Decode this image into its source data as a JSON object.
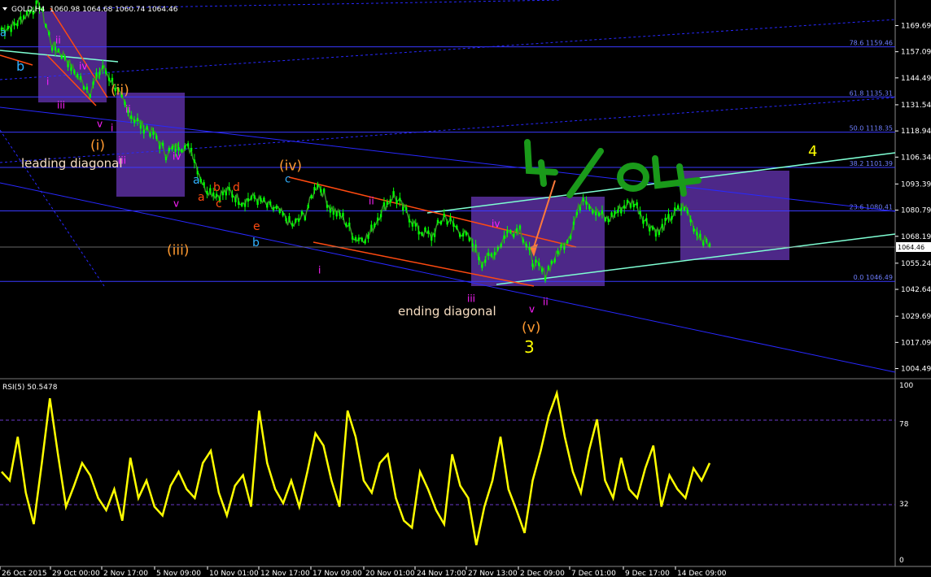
{
  "header": {
    "symbol": "GOLD,H4",
    "ohlc": "1060.98 1064.68 1060.74 1064.46"
  },
  "rsi_header": "RSI(5) 50.5478",
  "colors": {
    "background": "#000000",
    "bull_candle": "#00ff00",
    "price_line": "#3a8f2a",
    "channel_blue": "#2828ff",
    "fib_line": "#3a3aff",
    "orange_line": "#ff4a10",
    "cyan_line": "#7fffd4",
    "box_purple": "#5b2fa0",
    "rsi_line": "#ffff00",
    "yellow": "#ffff00",
    "magenta": "#ff20ff",
    "orange_text": "#ff9a30",
    "cyan_text": "#30b0ff",
    "red_text": "#ff4a10",
    "green_scribble": "#1a9a1a"
  },
  "annotations": {
    "leading_diagonal": "leading diagonal",
    "ending_diagonal": "ending diagonal",
    "wave_3": "3",
    "wave_4": "4"
  },
  "wave_labels": [
    {
      "t": "a",
      "c": "cyan_text"
    },
    {
      "t": "b",
      "c": "cyan_text"
    },
    {
      "t": "ii",
      "c": "magenta"
    },
    {
      "t": "i",
      "c": "magenta"
    },
    {
      "t": "iii",
      "c": "magenta"
    },
    {
      "t": "iv",
      "c": "magenta"
    },
    {
      "t": "v",
      "c": "magenta"
    },
    {
      "t": "(ii)",
      "c": "orange_text"
    },
    {
      "t": "ii",
      "c": "magenta"
    },
    {
      "t": "i",
      "c": "magenta"
    },
    {
      "t": "(i)",
      "c": "orange_text"
    },
    {
      "t": "iii",
      "c": "magenta"
    },
    {
      "t": "iv",
      "c": "magenta"
    },
    {
      "t": "v",
      "c": "magenta"
    },
    {
      "t": "(iii)",
      "c": "orange_text"
    },
    {
      "t": "a",
      "c": "cyan_text"
    },
    {
      "t": "a",
      "c": "red_text"
    },
    {
      "t": "b",
      "c": "red_text"
    },
    {
      "t": "c",
      "c": "red_text"
    },
    {
      "t": "d",
      "c": "red_text"
    },
    {
      "t": "e",
      "c": "red_text"
    },
    {
      "t": "b",
      "c": "cyan_text"
    },
    {
      "t": "(iv)",
      "c": "orange_text"
    },
    {
      "t": "c",
      "c": "cyan_text"
    },
    {
      "t": "ii",
      "c": "magenta"
    },
    {
      "t": "i",
      "c": "magenta"
    },
    {
      "t": "iii",
      "c": "magenta"
    },
    {
      "t": "iv",
      "c": "magenta"
    },
    {
      "t": "v",
      "c": "magenta"
    },
    {
      "t": "ii",
      "c": "magenta"
    },
    {
      "t": "(v)",
      "c": "orange_text"
    }
  ],
  "scribble_text": "4/04",
  "chart_data": [
    {
      "type": "candlestick",
      "title": "",
      "ylim": [
        1000,
        1182
      ],
      "price_ticks": [
        1169.69,
        1157.09,
        1144.49,
        1131.54,
        1118.94,
        1106.34,
        1093.39,
        1080.79,
        1068.19,
        1055.24,
        1042.64,
        1029.69,
        1017.09,
        1004.49
      ],
      "current_price": 1064.46,
      "x_ticks": [
        "26 Oct 2015",
        "29 Oct 00:00",
        "2 Nov 17:00",
        "5 Nov 09:00",
        "10 Nov 01:00",
        "12 Nov 17:00",
        "17 Nov 09:00",
        "20 Nov 01:00",
        "24 Nov 17:00",
        "27 Nov 13:00",
        "2 Dec 09:00",
        "7 Dec 01:00",
        "9 Dec 17:00",
        "14 Dec 09:00"
      ],
      "fib_levels": [
        {
          "label": "78.6 1159.46",
          "value": 1159.46
        },
        {
          "label": "61.8 1135.31",
          "value": 1135.31
        },
        {
          "label": "50.0 1118.35",
          "value": 1118.35
        },
        {
          "label": "38.2 1101.39",
          "value": 1101.39
        },
        {
          "label": "23.6 1080.41",
          "value": 1080.41
        },
        {
          "label": "0.0 1046.49",
          "value": 1046.49
        }
      ],
      "close_path": [
        [
          0,
          1168
        ],
        [
          1,
          1170
        ],
        [
          2,
          1175
        ],
        [
          3,
          1180
        ],
        [
          4,
          1160
        ],
        [
          5,
          1155
        ],
        [
          6,
          1145
        ],
        [
          7,
          1138
        ],
        [
          8,
          1150
        ],
        [
          9,
          1140
        ],
        [
          10,
          1128
        ],
        [
          11,
          1122
        ],
        [
          12,
          1118
        ],
        [
          13,
          1108
        ],
        [
          14,
          1112
        ],
        [
          15,
          1110
        ],
        [
          16,
          1092
        ],
        [
          17,
          1088
        ],
        [
          18,
          1090
        ],
        [
          19,
          1085
        ],
        [
          20,
          1087
        ],
        [
          21,
          1083
        ],
        [
          22,
          1080
        ],
        [
          23,
          1073
        ],
        [
          24,
          1079
        ],
        [
          25,
          1094
        ],
        [
          26,
          1082
        ],
        [
          27,
          1077
        ],
        [
          28,
          1067
        ],
        [
          29,
          1068
        ],
        [
          30,
          1080
        ],
        [
          31,
          1088
        ],
        [
          32,
          1080
        ],
        [
          33,
          1071
        ],
        [
          34,
          1068
        ],
        [
          35,
          1078
        ],
        [
          36,
          1072
        ],
        [
          37,
          1067
        ],
        [
          38,
          1056
        ],
        [
          39,
          1060
        ],
        [
          40,
          1070
        ],
        [
          41,
          1072
        ],
        [
          42,
          1056
        ],
        [
          43,
          1050
        ],
        [
          44,
          1060
        ],
        [
          45,
          1070
        ],
        [
          46,
          1088
        ],
        [
          47,
          1080
        ],
        [
          48,
          1076
        ],
        [
          49,
          1082
        ],
        [
          50,
          1085
        ],
        [
          51,
          1075
        ],
        [
          52,
          1070
        ],
        [
          53,
          1078
        ],
        [
          54,
          1083
        ],
        [
          55,
          1070
        ],
        [
          56,
          1064
        ]
      ]
    },
    {
      "type": "line",
      "title": "RSI(5) 50.5478",
      "ylim": [
        0,
        100
      ],
      "y_ticks": [
        100,
        78,
        32,
        0
      ],
      "values": [
        50,
        45,
        70,
        38,
        20,
        55,
        92,
        60,
        30,
        42,
        55,
        48,
        35,
        28,
        40,
        22,
        58,
        35,
        45,
        30,
        25,
        42,
        50,
        40,
        35,
        55,
        62,
        38,
        25,
        42,
        48,
        30,
        85,
        55,
        40,
        32,
        45,
        30,
        50,
        72,
        65,
        45,
        30,
        85,
        70,
        45,
        38,
        55,
        60,
        35,
        22,
        18,
        50,
        40,
        28,
        20,
        60,
        42,
        35,
        8,
        30,
        45,
        70,
        40,
        28,
        15,
        45,
        62,
        82,
        95,
        70,
        50,
        38,
        62,
        80,
        45,
        35,
        58,
        40,
        35,
        52,
        65,
        30,
        48,
        40,
        35,
        52,
        45,
        55
      ]
    }
  ]
}
